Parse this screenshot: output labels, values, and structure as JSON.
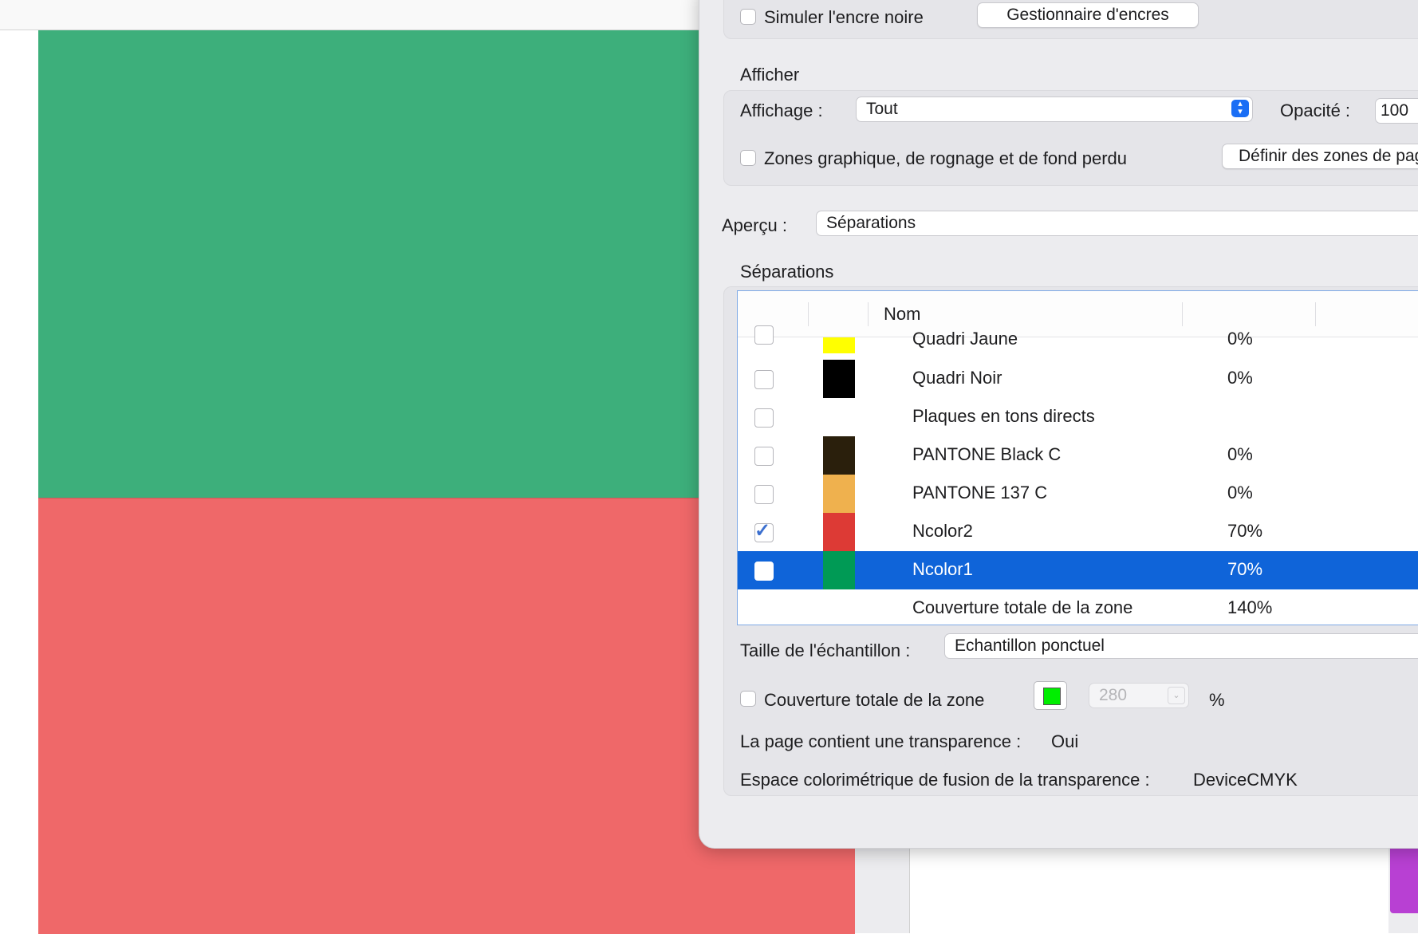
{
  "panel": {
    "simulate_black_ink": {
      "label": "Simuler l'encre noire",
      "checked": false
    },
    "ink_manager_button": "Gestionnaire d'encres",
    "show_section_title": "Afficher",
    "display_label": "Affichage :",
    "display_value": "Tout",
    "opacity_label": "Opacité :",
    "opacity_value": "100",
    "zones_checkbox": {
      "label": "Zones graphique, de rognage et de fond perdu",
      "checked": false
    },
    "define_zones_button": "Définir des zones de pag",
    "preview_label": "Aperçu :",
    "preview_value": "Séparations",
    "separations_title": "Séparations",
    "table_header_name": "Nom",
    "separations": [
      {
        "name": "Quadri Jaune",
        "pct": "0%",
        "color": "#ffff00",
        "checked": false
      },
      {
        "name": "Quadri Noir",
        "pct": "0%",
        "color": "#000000",
        "checked": false
      },
      {
        "name": "Plaques en tons directs",
        "pct": "",
        "color": "",
        "checked": false
      },
      {
        "name": "PANTONE Black C",
        "pct": "0%",
        "color": "#2a1f0c",
        "checked": false
      },
      {
        "name": "PANTONE 137 C",
        "pct": "0%",
        "color": "#efb14e",
        "checked": false
      },
      {
        "name": "Ncolor2",
        "pct": "70%",
        "color": "#dd3a35",
        "checked": true
      },
      {
        "name": "Ncolor1",
        "pct": "70%",
        "color": "#009a55",
        "checked": true,
        "selected": true
      }
    ],
    "total_row": {
      "name": "Couverture totale de la zone",
      "pct": "140%"
    },
    "sample_size_label": "Taille de l'échantillon :",
    "sample_size_value": "Echantillon ponctuel",
    "total_coverage": {
      "label": "Couverture totale de la zone",
      "checked": false,
      "swatch_color": "#00ee00",
      "value": "280",
      "unit": "%"
    },
    "transparency_label": "La page contient une transparence :",
    "transparency_value": "Oui",
    "blend_space_label": "Espace colorimétrique de fusion de la transparence :",
    "blend_space_value": "DeviceCMYK"
  }
}
